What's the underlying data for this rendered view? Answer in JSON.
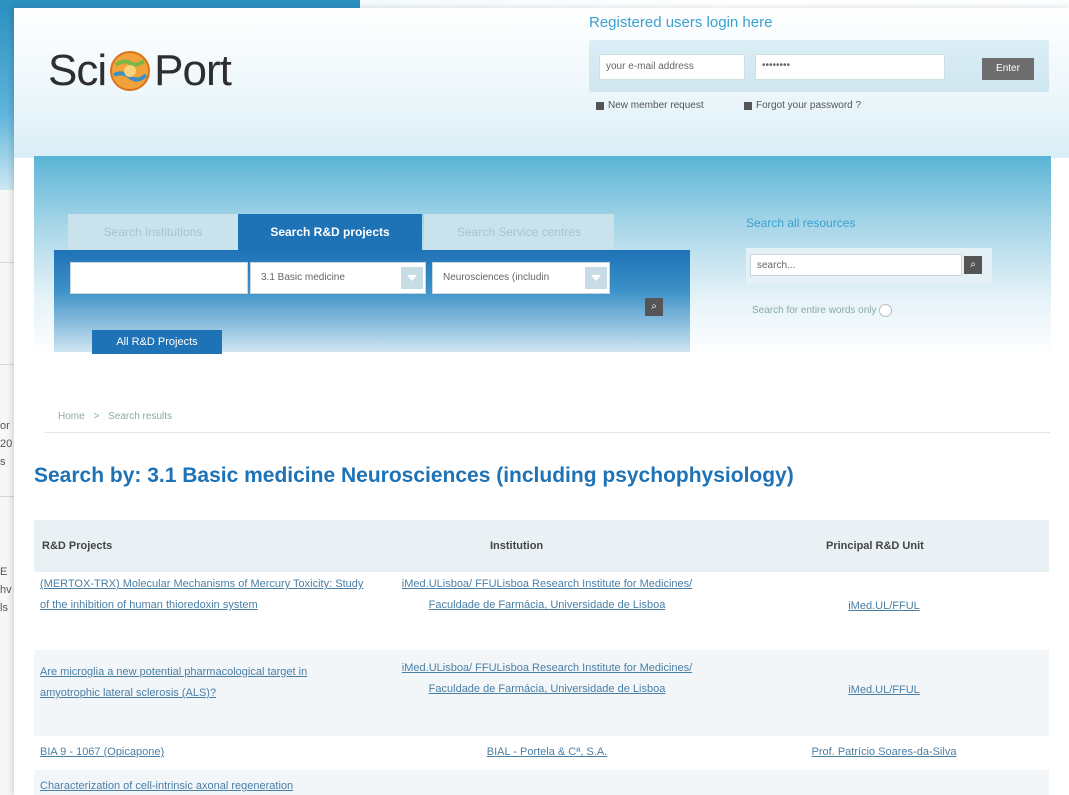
{
  "background_fragments": [
    "or",
    "20",
    "s",
    "E",
    "hv",
    "ls"
  ],
  "logo": {
    "left": "Sci",
    "right": "Port"
  },
  "login": {
    "title": "Registered users login here",
    "email_placeholder": "your e-mail address",
    "password_value": "••••••••",
    "enter_label": "Enter",
    "new_member": "New member request",
    "forgot": "Forgot your password ?"
  },
  "tabs": [
    {
      "label": "Search Institutions",
      "active": false
    },
    {
      "label": "Search R&D projects",
      "active": true
    },
    {
      "label": "Search Service centres",
      "active": false
    }
  ],
  "search": {
    "text_value": "",
    "select1": "3.1 Basic medicine",
    "select2": "Neurosciences (includin",
    "all_projects_label": "All R&D Projects"
  },
  "search_all": {
    "title": "Search all resources",
    "placeholder": "search...",
    "entire_words": "Search for entire words only"
  },
  "breadcrumb": {
    "home": "Home",
    "sep": ">",
    "current": "Search results"
  },
  "page_title": "Search by: 3.1 Basic medicine Neurosciences (including psychophysiology)",
  "table": {
    "headers": [
      "R&D Projects",
      "Institution",
      "Principal R&D Unit"
    ],
    "rows": [
      {
        "project": "(MERTOX-TRX) Molecular Mechanisms of Mercury Toxicity: Study of the inhibition of human thioredoxin system",
        "institution": "iMed.ULisboa/ FFULisboa Research Institute for Medicines/ Faculdade de Farmácia, Universidade de Lisboa",
        "unit": "iMed.UL/FFUL"
      },
      {
        "project": "Are microglia a new potential pharmacological target in amyotrophic lateral sclerosis (ALS)?",
        "institution": "iMed.ULisboa/ FFULisboa Research Institute for Medicines/ Faculdade de Farmácia, Universidade de Lisboa",
        "unit": "iMed.UL/FFUL"
      },
      {
        "project": "BIA 9 - 1067 (Opicapone)",
        "institution": "BIAL - Portela & Cª, S.A.",
        "unit": "Prof. Patrício Soares-da-Silva"
      },
      {
        "project": "Characterization of cell-intrinsic axonal regeneration",
        "institution": "",
        "unit": ""
      }
    ]
  }
}
